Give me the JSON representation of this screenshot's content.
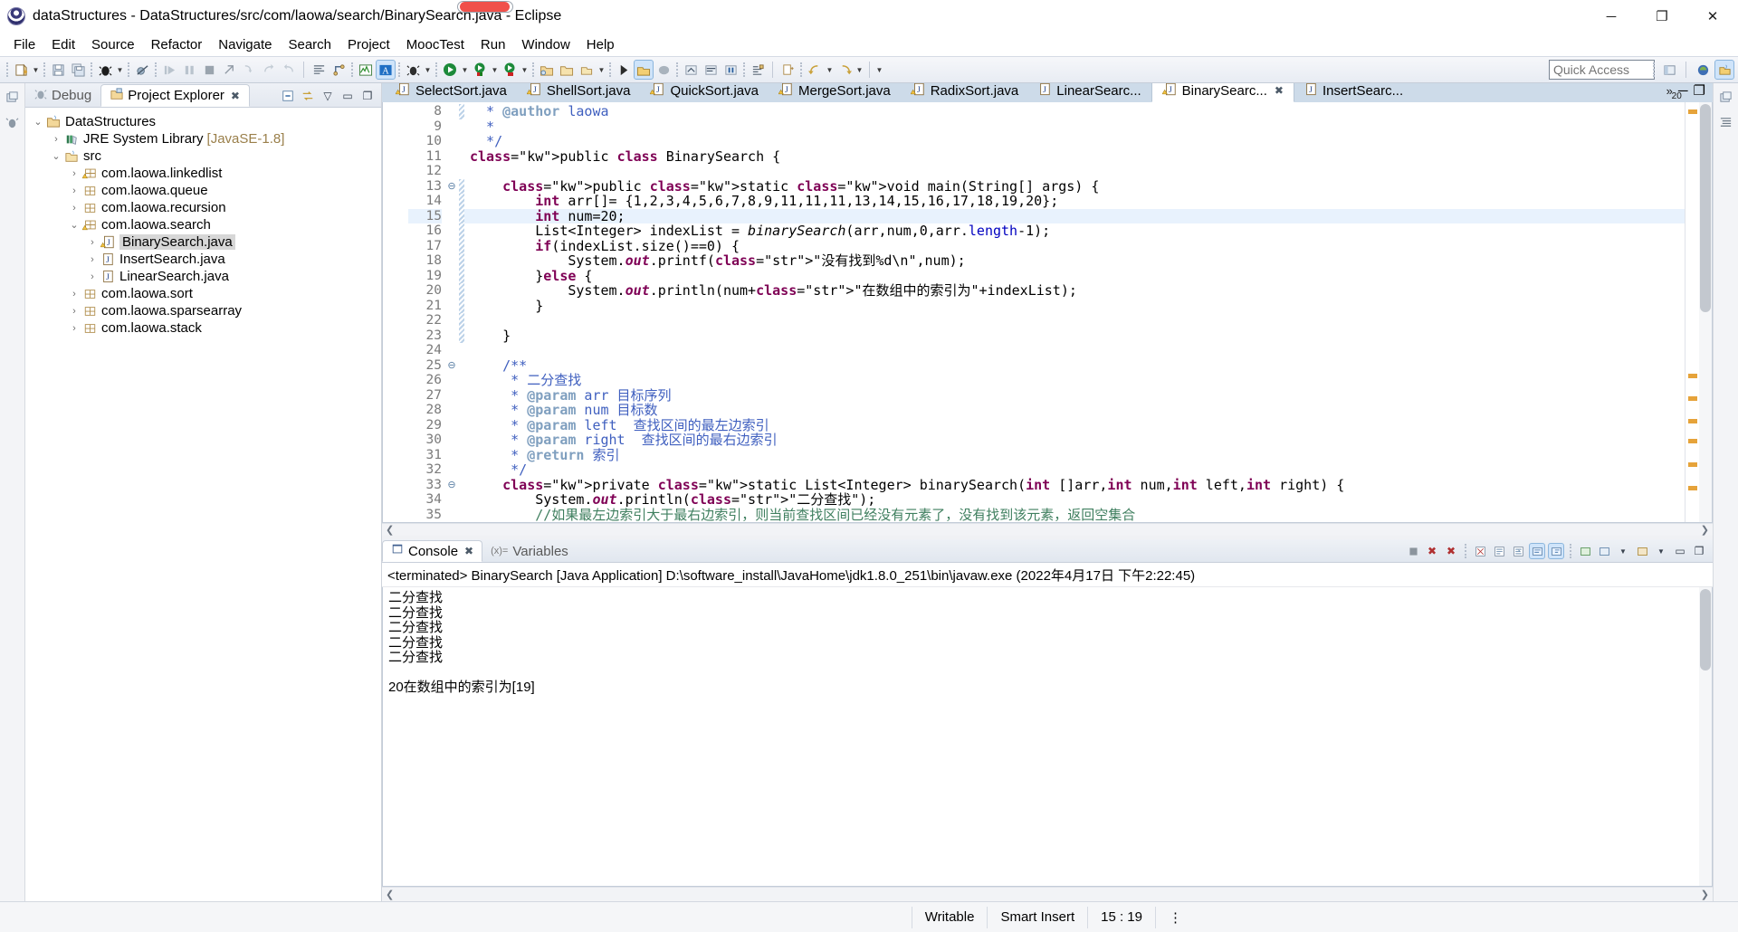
{
  "window": {
    "title": "dataStructures - DataStructures/src/com/laowa/search/BinarySearch.java - Eclipse",
    "minimize": "─",
    "maximize": "❐",
    "close": "✕"
  },
  "menu": [
    "File",
    "Edit",
    "Source",
    "Refactor",
    "Navigate",
    "Search",
    "Project",
    "MoocTest",
    "Run",
    "Window",
    "Help"
  ],
  "toolbar": {
    "quick_access_placeholder": "Quick Access",
    "quick_access_value": "",
    "icons": [
      "new-wizard-icon",
      "save-icon",
      "save-all-icon",
      "debug-icon",
      "skip-breakpoints-icon",
      "resume-icon",
      "suspend-icon",
      "terminate-icon",
      "disconnect-icon",
      "step-into-icon",
      "step-over-icon",
      "step-return-icon",
      "open-task-icon",
      "link-icon",
      "mooc-icon",
      "annotation-icon",
      "debug-perspective-icon",
      "run-icon",
      "run-last-icon",
      "external-tools-icon",
      "new-java-project-icon",
      "new-package-icon",
      "new-class-icon",
      "search-icon",
      "java-perspective-icon",
      "open-type-icon",
      "next-annotation-icon",
      "previous-annotation-icon",
      "last-edit-icon",
      "back-icon",
      "forward-icon",
      "pin-editor-icon"
    ]
  },
  "left_rail": {
    "icons": [
      "restore-view-icon",
      "debug-view-icon"
    ]
  },
  "right_rail": {
    "icons": [
      "outline-view-icon",
      "task-list-icon"
    ]
  },
  "explorer": {
    "tabs": [
      {
        "label": "Debug",
        "icon": "debug-view-icon",
        "selected": false,
        "closable": false
      },
      {
        "label": "Project Explorer",
        "icon": "project-explorer-icon",
        "selected": true,
        "closable": true
      }
    ],
    "tools": [
      "collapse-all-icon",
      "link-with-editor-icon",
      "view-menu-icon"
    ],
    "tree": [
      {
        "label": "DataStructures",
        "depth": 0,
        "twist": "v",
        "icon": "java-project-icon",
        "suffix": "",
        "selected": false
      },
      {
        "label": "JRE System Library",
        "depth": 1,
        "twist": ">",
        "icon": "jre-library-icon",
        "suffix": "[JavaSE-1.8]",
        "selected": false
      },
      {
        "label": "src",
        "depth": 1,
        "twist": "v",
        "icon": "source-folder-icon",
        "suffix": "",
        "selected": false
      },
      {
        "label": "com.laowa.linkedlist",
        "depth": 2,
        "twist": ">",
        "icon": "package-warning-icon",
        "suffix": "",
        "selected": false
      },
      {
        "label": "com.laowa.queue",
        "depth": 2,
        "twist": ">",
        "icon": "package-icon",
        "suffix": "",
        "selected": false
      },
      {
        "label": "com.laowa.recursion",
        "depth": 2,
        "twist": ">",
        "icon": "package-icon",
        "suffix": "",
        "selected": false
      },
      {
        "label": "com.laowa.search",
        "depth": 2,
        "twist": "v",
        "icon": "package-warning-icon",
        "suffix": "",
        "selected": false
      },
      {
        "label": "BinarySearch.java",
        "depth": 3,
        "twist": ">",
        "icon": "java-file-warning-icon",
        "suffix": "",
        "selected": true
      },
      {
        "label": "InsertSearch.java",
        "depth": 3,
        "twist": ">",
        "icon": "java-file-icon",
        "suffix": "",
        "selected": false
      },
      {
        "label": "LinearSearch.java",
        "depth": 3,
        "twist": ">",
        "icon": "java-file-icon",
        "suffix": "",
        "selected": false
      },
      {
        "label": "com.laowa.sort",
        "depth": 2,
        "twist": ">",
        "icon": "package-icon",
        "suffix": "",
        "selected": false
      },
      {
        "label": "com.laowa.sparsearray",
        "depth": 2,
        "twist": ">",
        "icon": "package-icon",
        "suffix": "",
        "selected": false
      },
      {
        "label": "com.laowa.stack",
        "depth": 2,
        "twist": ">",
        "icon": "package-icon",
        "suffix": "",
        "selected": false
      }
    ]
  },
  "editor": {
    "tabs": [
      {
        "label": "SelectSort.java",
        "icon": "java-file-warning-icon",
        "selected": false
      },
      {
        "label": "ShellSort.java",
        "icon": "java-file-warning-icon",
        "selected": false
      },
      {
        "label": "QuickSort.java",
        "icon": "java-file-warning-icon",
        "selected": false
      },
      {
        "label": "MergeSort.java",
        "icon": "java-file-warning-icon",
        "selected": false
      },
      {
        "label": "RadixSort.java",
        "icon": "java-file-warning-icon",
        "selected": false
      },
      {
        "label": "LinearSearc...",
        "icon": "java-file-icon",
        "selected": false
      },
      {
        "label": "BinarySearc...",
        "icon": "java-file-warning-icon",
        "selected": true
      },
      {
        "label": "InsertSearc...",
        "icon": "java-file-icon",
        "selected": false
      }
    ],
    "overflow_label": "20",
    "restore_label": "─",
    "maximize_label": "❐",
    "close_label": "✕",
    "first_line_number": 8,
    "lines": [
      {
        "n": 8,
        "text": "  * @author laowa"
      },
      {
        "n": 9,
        "text": "  *"
      },
      {
        "n": 10,
        "text": "  */"
      },
      {
        "n": 11,
        "text": "public class BinarySearch {"
      },
      {
        "n": 12,
        "text": ""
      },
      {
        "n": 13,
        "text": "    public static void main(String[] args) {",
        "fold": true
      },
      {
        "n": 14,
        "text": "        int arr[]= {1,2,3,4,5,6,7,8,9,11,11,11,13,14,15,16,17,18,19,20};"
      },
      {
        "n": 15,
        "text": "        int num=20;",
        "current": true
      },
      {
        "n": 16,
        "text": "        List<Integer> indexList = binarySearch(arr,num,0,arr.length-1);"
      },
      {
        "n": 17,
        "text": "        if(indexList.size()==0) {"
      },
      {
        "n": 18,
        "text": "            System.out.printf(\"没有找到%d\\n\",num);"
      },
      {
        "n": 19,
        "text": "        }else {"
      },
      {
        "n": 20,
        "text": "            System.out.println(num+\"在数组中的索引为\"+indexList);"
      },
      {
        "n": 21,
        "text": "        }"
      },
      {
        "n": 22,
        "text": ""
      },
      {
        "n": 23,
        "text": "    }"
      },
      {
        "n": 24,
        "text": ""
      },
      {
        "n": 25,
        "text": "    /**",
        "fold": true
      },
      {
        "n": 26,
        "text": "     * 二分查找"
      },
      {
        "n": 27,
        "text": "     * @param arr 目标序列"
      },
      {
        "n": 28,
        "text": "     * @param num 目标数"
      },
      {
        "n": 29,
        "text": "     * @param left  查找区间的最左边索引"
      },
      {
        "n": 30,
        "text": "     * @param right  查找区间的最右边索引"
      },
      {
        "n": 31,
        "text": "     * @return 索引"
      },
      {
        "n": 32,
        "text": "     */"
      },
      {
        "n": 33,
        "text": "    private static List<Integer> binarySearch(int []arr,int num,int left,int right) {",
        "fold": true
      },
      {
        "n": 34,
        "text": "        System.out.println(\"二分查找\");"
      },
      {
        "n": 35,
        "text": "        //如果最左边索引大于最右边索引，则当前查找区间已经没有元素了，没有找到该元素，返回空集合"
      }
    ]
  },
  "console": {
    "tabs": [
      {
        "label": "Console",
        "icon": "console-icon",
        "selected": true,
        "closable": true
      },
      {
        "label": "Variables",
        "icon": "variables-icon",
        "selected": false,
        "closable": false
      }
    ],
    "tools": [
      "terminate-icon",
      "remove-launch-icon",
      "remove-all-launches-icon",
      "clear-console-icon",
      "scroll-lock-icon",
      "word-wrap-icon",
      "show-console-on-output-icon",
      "pin-console-icon",
      "display-selected-console-icon",
      "open-console-icon",
      "minimize-icon",
      "maximize-icon"
    ],
    "header": "<terminated> BinarySearch [Java Application] D:\\software_install\\JavaHome\\jdk1.8.0_251\\bin\\javaw.exe (2022年4月17日 下午2:22:45)",
    "output": [
      "二分查找",
      "二分查找",
      "二分查找",
      "二分查找",
      "二分查找",
      "",
      "20在数组中的索引为[19]"
    ]
  },
  "statusbar": {
    "writable": "Writable",
    "insert_mode": "Smart Insert",
    "position": "15 : 19",
    "more": "⋮"
  },
  "colors": {
    "accent": "#cddbe9",
    "keyword": "#7f0055",
    "string": "#2a00ff",
    "comment": "#3f7f5f",
    "javadoc": "#3f5fbf",
    "javadoc_tag": "#7f9fbf",
    "selection": "#e8f2fd"
  }
}
